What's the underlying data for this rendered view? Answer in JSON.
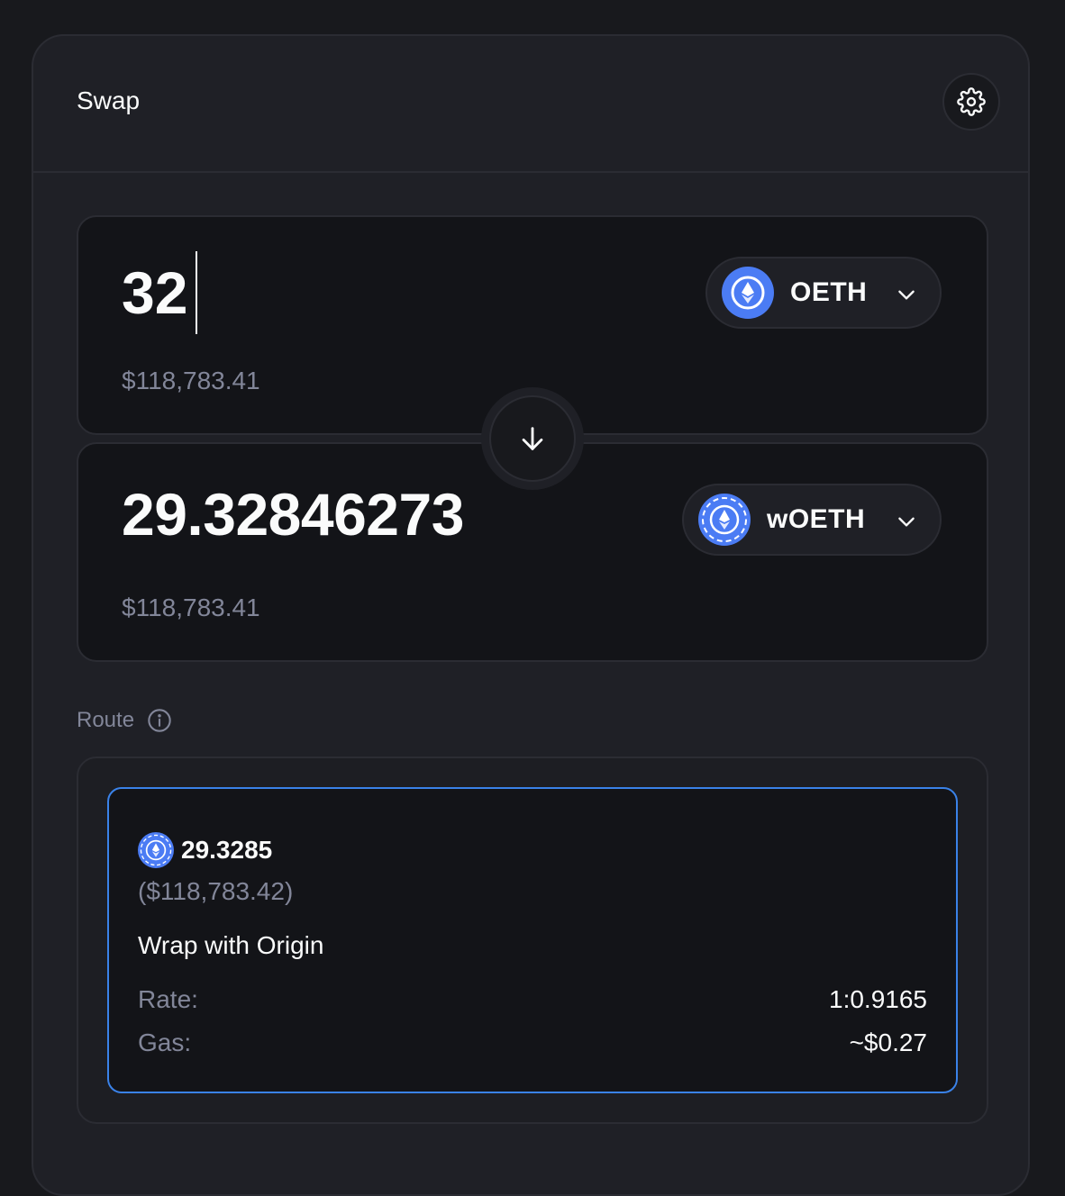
{
  "header": {
    "title": "Swap",
    "settings_icon": "gear-icon"
  },
  "input": {
    "amount": "32",
    "usd_value": "$118,783.41",
    "token": {
      "symbol": "OETH",
      "icon": "oeth-token-icon"
    }
  },
  "output": {
    "amount": "29.32846273",
    "usd_value": "$118,783.41",
    "token": {
      "symbol": "wOETH",
      "icon": "woeth-token-icon"
    }
  },
  "switch": {
    "icon": "arrow-down-icon"
  },
  "route": {
    "label": "Route",
    "options": [
      {
        "amount": "29.3285",
        "usd_value": "($118,783.42)",
        "name": "Wrap with Origin",
        "rate_label": "Rate:",
        "rate_value": "1:0.9165",
        "gas_label": "Gas:",
        "gas_value": "~$0.27",
        "selected": true
      }
    ]
  },
  "colors": {
    "background": "#18191d",
    "card": "#1f2026",
    "border": "#2b2c33",
    "accent": "#3a82e8",
    "token_blue": "#4b7cf4",
    "muted_text": "#828699",
    "text": "#fafbfb"
  }
}
